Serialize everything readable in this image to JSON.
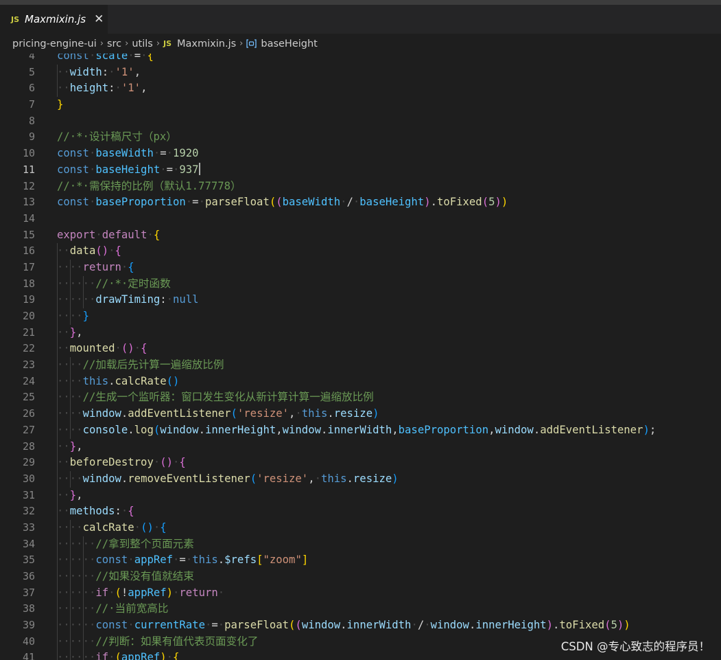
{
  "tab": {
    "icon_label": "JS",
    "filename": "Maxmixin.js",
    "close": "✕"
  },
  "breadcrumb": {
    "items": [
      "pricing-engine-ui",
      "src",
      "utils"
    ],
    "file_icon": "JS",
    "file": "Maxmixin.js",
    "symbol_icon": "symbol-variable-icon",
    "symbol": "baseHeight",
    "separator": "›"
  },
  "editor": {
    "active_line": 11,
    "lines": [
      {
        "n": 4,
        "indent": 0,
        "tokens": [
          [
            "kw",
            "const"
          ],
          [
            "ws",
            "·"
          ],
          [
            "var",
            "scale"
          ],
          [
            "ws",
            "·"
          ],
          [
            "punc",
            "="
          ],
          [
            "ws",
            "·"
          ],
          [
            "br1",
            "{"
          ]
        ]
      },
      {
        "n": 5,
        "indent": 1,
        "tokens": [
          [
            "prop",
            "width"
          ],
          [
            "punc",
            ":"
          ],
          [
            "ws",
            "·"
          ],
          [
            "str",
            "'1'"
          ],
          [
            "punc",
            ","
          ]
        ]
      },
      {
        "n": 6,
        "indent": 1,
        "tokens": [
          [
            "prop",
            "height"
          ],
          [
            "punc",
            ":"
          ],
          [
            "ws",
            "·"
          ],
          [
            "str",
            "'1'"
          ],
          [
            "punc",
            ","
          ]
        ]
      },
      {
        "n": 7,
        "indent": 0,
        "tokens": [
          [
            "br1",
            "}"
          ]
        ]
      },
      {
        "n": 8,
        "indent": 0,
        "tokens": []
      },
      {
        "n": 9,
        "indent": 0,
        "tokens": [
          [
            "com",
            "//·*·设计稿尺寸（px）"
          ]
        ]
      },
      {
        "n": 10,
        "indent": 0,
        "tokens": [
          [
            "kw",
            "const"
          ],
          [
            "ws",
            "·"
          ],
          [
            "var",
            "baseWidth"
          ],
          [
            "ws",
            "·"
          ],
          [
            "punc",
            "="
          ],
          [
            "ws",
            "·"
          ],
          [
            "num",
            "1920"
          ]
        ]
      },
      {
        "n": 11,
        "indent": 0,
        "tokens": [
          [
            "kw",
            "const"
          ],
          [
            "ws",
            "·"
          ],
          [
            "var",
            "baseHeight"
          ],
          [
            "ws",
            "·"
          ],
          [
            "punc",
            "="
          ],
          [
            "ws",
            "·"
          ],
          [
            "num",
            "937"
          ]
        ],
        "cursor": true
      },
      {
        "n": 12,
        "indent": 0,
        "tokens": [
          [
            "com",
            "//·*·需保持的比例（默认1.77778）"
          ]
        ]
      },
      {
        "n": 13,
        "indent": 0,
        "tokens": [
          [
            "kw",
            "const"
          ],
          [
            "ws",
            "·"
          ],
          [
            "var",
            "baseProportion"
          ],
          [
            "ws",
            "·"
          ],
          [
            "punc",
            "="
          ],
          [
            "ws",
            "·"
          ],
          [
            "fn",
            "parseFloat"
          ],
          [
            "br1",
            "("
          ],
          [
            "br2",
            "("
          ],
          [
            "var",
            "baseWidth"
          ],
          [
            "ws",
            "·"
          ],
          [
            "punc",
            "/"
          ],
          [
            "ws",
            "·"
          ],
          [
            "var",
            "baseHeight"
          ],
          [
            "br2",
            ")"
          ],
          [
            "punc",
            "."
          ],
          [
            "fn",
            "toFixed"
          ],
          [
            "br2",
            "("
          ],
          [
            "num",
            "5"
          ],
          [
            "br2",
            ")"
          ],
          [
            "br1",
            ")"
          ]
        ]
      },
      {
        "n": 14,
        "indent": 0,
        "tokens": []
      },
      {
        "n": 15,
        "indent": 0,
        "tokens": [
          [
            "ctl",
            "export"
          ],
          [
            "ws",
            "·"
          ],
          [
            "ctl",
            "default"
          ],
          [
            "ws",
            "·"
          ],
          [
            "br1",
            "{"
          ]
        ]
      },
      {
        "n": 16,
        "indent": 1,
        "tokens": [
          [
            "fn",
            "data"
          ],
          [
            "br2",
            "()"
          ],
          [
            "ws",
            "·"
          ],
          [
            "br2",
            "{"
          ]
        ]
      },
      {
        "n": 17,
        "indent": 2,
        "tokens": [
          [
            "ctl",
            "return"
          ],
          [
            "ws",
            "·"
          ],
          [
            "br3",
            "{"
          ]
        ]
      },
      {
        "n": 18,
        "indent": 3,
        "tokens": [
          [
            "com",
            "//·*·定时函数"
          ]
        ]
      },
      {
        "n": 19,
        "indent": 3,
        "tokens": [
          [
            "prop",
            "drawTiming"
          ],
          [
            "punc",
            ":"
          ],
          [
            "ws",
            "·"
          ],
          [
            "kw",
            "null"
          ]
        ]
      },
      {
        "n": 20,
        "indent": 2,
        "tokens": [
          [
            "br3",
            "}"
          ]
        ]
      },
      {
        "n": 21,
        "indent": 1,
        "tokens": [
          [
            "br2",
            "}"
          ],
          [
            "punc",
            ","
          ]
        ]
      },
      {
        "n": 22,
        "indent": 1,
        "tokens": [
          [
            "fn",
            "mounted"
          ],
          [
            "ws",
            "·"
          ],
          [
            "br2",
            "()"
          ],
          [
            "ws",
            "·"
          ],
          [
            "br2",
            "{"
          ]
        ]
      },
      {
        "n": 23,
        "indent": 2,
        "tokens": [
          [
            "com",
            "//加载后先计算一遍缩放比例"
          ]
        ]
      },
      {
        "n": 24,
        "indent": 2,
        "tokens": [
          [
            "this",
            "this"
          ],
          [
            "punc",
            "."
          ],
          [
            "fn",
            "calcRate"
          ],
          [
            "br3",
            "()"
          ]
        ]
      },
      {
        "n": 25,
        "indent": 2,
        "tokens": [
          [
            "com",
            "//生成一个监听器：窗口发生变化从新计算计算一遍缩放比例"
          ]
        ]
      },
      {
        "n": 26,
        "indent": 2,
        "tokens": [
          [
            "prop",
            "window"
          ],
          [
            "punc",
            "."
          ],
          [
            "fn",
            "addEventListener"
          ],
          [
            "br3",
            "("
          ],
          [
            "str",
            "'resize'"
          ],
          [
            "punc",
            ","
          ],
          [
            "ws",
            "·"
          ],
          [
            "this",
            "this"
          ],
          [
            "punc",
            "."
          ],
          [
            "prop",
            "resize"
          ],
          [
            "br3",
            ")"
          ]
        ]
      },
      {
        "n": 27,
        "indent": 2,
        "tokens": [
          [
            "prop",
            "console"
          ],
          [
            "punc",
            "."
          ],
          [
            "fn",
            "log"
          ],
          [
            "br3",
            "("
          ],
          [
            "prop",
            "window"
          ],
          [
            "punc",
            "."
          ],
          [
            "prop",
            "innerHeight"
          ],
          [
            "punc",
            ","
          ],
          [
            "prop",
            "window"
          ],
          [
            "punc",
            "."
          ],
          [
            "prop",
            "innerWidth"
          ],
          [
            "punc",
            ","
          ],
          [
            "var",
            "baseProportion"
          ],
          [
            "punc",
            ","
          ],
          [
            "prop",
            "window"
          ],
          [
            "punc",
            "."
          ],
          [
            "fn",
            "addEventListener"
          ],
          [
            "br3",
            ")"
          ],
          [
            "punc",
            ";"
          ]
        ]
      },
      {
        "n": 28,
        "indent": 1,
        "tokens": [
          [
            "br2",
            "}"
          ],
          [
            "punc",
            ","
          ]
        ]
      },
      {
        "n": 29,
        "indent": 1,
        "tokens": [
          [
            "fn",
            "beforeDestroy"
          ],
          [
            "ws",
            "·"
          ],
          [
            "br2",
            "()"
          ],
          [
            "ws",
            "·"
          ],
          [
            "br2",
            "{"
          ]
        ]
      },
      {
        "n": 30,
        "indent": 2,
        "tokens": [
          [
            "prop",
            "window"
          ],
          [
            "punc",
            "."
          ],
          [
            "fn",
            "removeEventListener"
          ],
          [
            "br3",
            "("
          ],
          [
            "str",
            "'resize'"
          ],
          [
            "punc",
            ","
          ],
          [
            "ws",
            "·"
          ],
          [
            "this",
            "this"
          ],
          [
            "punc",
            "."
          ],
          [
            "prop",
            "resize"
          ],
          [
            "br3",
            ")"
          ]
        ]
      },
      {
        "n": 31,
        "indent": 1,
        "tokens": [
          [
            "br2",
            "}"
          ],
          [
            "punc",
            ","
          ]
        ]
      },
      {
        "n": 32,
        "indent": 1,
        "tokens": [
          [
            "prop",
            "methods"
          ],
          [
            "punc",
            ":"
          ],
          [
            "ws",
            "·"
          ],
          [
            "br2",
            "{"
          ]
        ]
      },
      {
        "n": 33,
        "indent": 2,
        "tokens": [
          [
            "fn",
            "calcRate"
          ],
          [
            "ws",
            "·"
          ],
          [
            "br3",
            "()"
          ],
          [
            "ws",
            "·"
          ],
          [
            "br3",
            "{"
          ]
        ]
      },
      {
        "n": 34,
        "indent": 3,
        "tokens": [
          [
            "com",
            "//拿到整个页面元素"
          ]
        ]
      },
      {
        "n": 35,
        "indent": 3,
        "tokens": [
          [
            "kw",
            "const"
          ],
          [
            "ws",
            "·"
          ],
          [
            "var",
            "appRef"
          ],
          [
            "ws",
            "·"
          ],
          [
            "punc",
            "="
          ],
          [
            "ws",
            "·"
          ],
          [
            "this",
            "this"
          ],
          [
            "punc",
            "."
          ],
          [
            "prop",
            "$refs"
          ],
          [
            "br1",
            "["
          ],
          [
            "str",
            "\"zoom\""
          ],
          [
            "br1",
            "]"
          ]
        ]
      },
      {
        "n": 36,
        "indent": 3,
        "tokens": [
          [
            "com",
            "//如果没有值就结束"
          ]
        ]
      },
      {
        "n": 37,
        "indent": 3,
        "tokens": [
          [
            "ctl",
            "if"
          ],
          [
            "ws",
            "·"
          ],
          [
            "br1",
            "("
          ],
          [
            "punc",
            "!"
          ],
          [
            "var",
            "appRef"
          ],
          [
            "br1",
            ")"
          ],
          [
            "ws",
            "·"
          ],
          [
            "ctl",
            "return"
          ],
          [
            "ws",
            "·"
          ]
        ]
      },
      {
        "n": 38,
        "indent": 3,
        "tokens": [
          [
            "com",
            "//·当前宽高比"
          ]
        ]
      },
      {
        "n": 39,
        "indent": 3,
        "tokens": [
          [
            "kw",
            "const"
          ],
          [
            "ws",
            "·"
          ],
          [
            "var",
            "currentRate"
          ],
          [
            "ws",
            "·"
          ],
          [
            "punc",
            "="
          ],
          [
            "ws",
            "·"
          ],
          [
            "fn",
            "parseFloat"
          ],
          [
            "br1",
            "("
          ],
          [
            "br2",
            "("
          ],
          [
            "prop",
            "window"
          ],
          [
            "punc",
            "."
          ],
          [
            "prop",
            "innerWidth"
          ],
          [
            "ws",
            "·"
          ],
          [
            "punc",
            "/"
          ],
          [
            "ws",
            "·"
          ],
          [
            "prop",
            "window"
          ],
          [
            "punc",
            "."
          ],
          [
            "prop",
            "innerHeight"
          ],
          [
            "br2",
            ")"
          ],
          [
            "punc",
            "."
          ],
          [
            "fn",
            "toFixed"
          ],
          [
            "br2",
            "("
          ],
          [
            "num",
            "5"
          ],
          [
            "br2",
            ")"
          ],
          [
            "br1",
            ")"
          ]
        ]
      },
      {
        "n": 40,
        "indent": 3,
        "tokens": [
          [
            "com",
            "//判断：如果有值代表页面变化了"
          ]
        ]
      },
      {
        "n": 41,
        "indent": 3,
        "tokens": [
          [
            "ctl",
            "if"
          ],
          [
            "ws",
            "·"
          ],
          [
            "br1",
            "("
          ],
          [
            "var",
            "appRef"
          ],
          [
            "br1",
            ")"
          ],
          [
            "ws",
            "·"
          ],
          [
            "br1",
            "{"
          ]
        ]
      }
    ]
  },
  "watermark": "CSDN @专心致志的程序员！"
}
